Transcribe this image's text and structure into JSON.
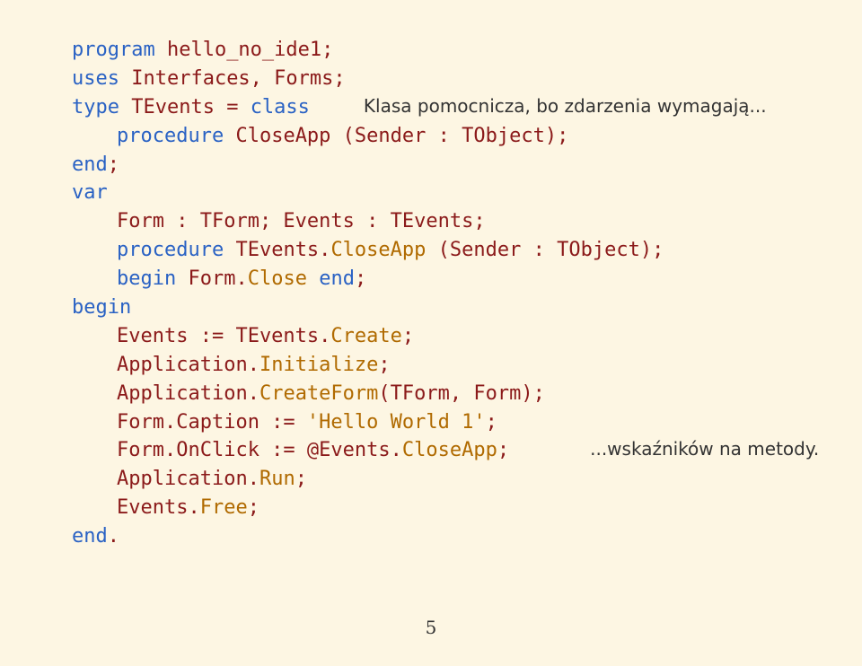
{
  "code": {
    "l1a": "program",
    "l1b": " hello_no_ide1;",
    "l2a": "uses",
    "l2b": " Interfaces, Forms;",
    "l3a": "type",
    "l3b": " TEvents = ",
    "l3c": "class",
    "l4a": "procedure",
    "l4b": " CloseApp (Sender : TObject);",
    "l5": "end",
    "semi": ";",
    "l6": "var",
    "l7": "Form : TForm; Events : TEvents;",
    "l8a": "procedure",
    "l8b": " TEvents.",
    "l8c": "CloseApp",
    "l8d": " (Sender : TObject);",
    "l9a": "begin",
    "l9b": " Form.",
    "l9c": "Close",
    "l9d": " ",
    "l9e": "end",
    "l10": "begin",
    "l11a": "Events := TEvents.",
    "l11b": "Create",
    "l12a": "Application.",
    "l12b": "Initialize",
    "l13a": "Application.",
    "l13b": "CreateForm",
    "l13c": "(TForm, Form);",
    "l14a": "Form.Caption := ",
    "l14b": "'Hello World 1'",
    "l15a": "Form.OnClick := @Events.",
    "l15b": "CloseApp",
    "l16a": "Application.",
    "l16b": "Run",
    "l17a": "Events.",
    "l17b": "Free",
    "l18": "end",
    "dot": "."
  },
  "comments": {
    "c1": "Klasa pomocnicza, bo zdarzenia wymagają...",
    "c2": "...wskaźników na metody."
  },
  "pagenum": "5"
}
